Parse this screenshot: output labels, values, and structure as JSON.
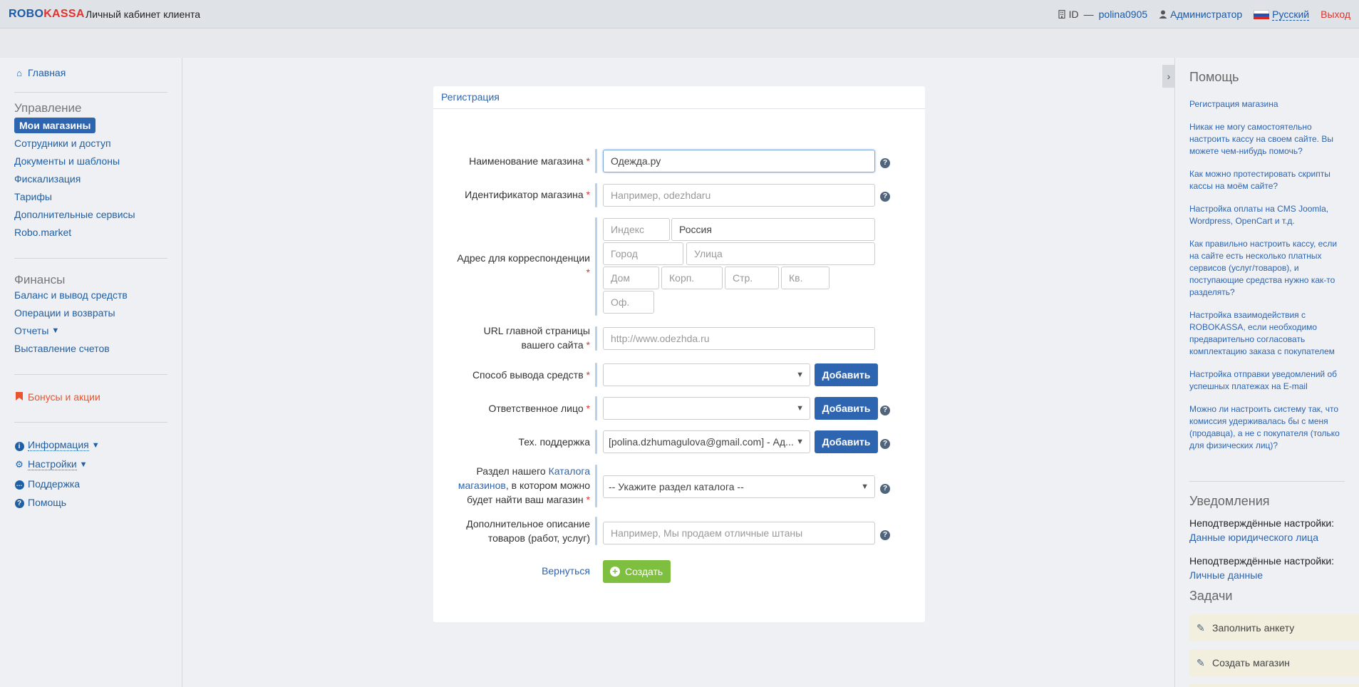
{
  "header": {
    "logo_robo": "ROBO",
    "logo_kassa": "KASSA",
    "cabinet_title": "Личный кабинет клиента",
    "id_label": "ID",
    "id_dash": "—",
    "user_login": "polina0905",
    "role": "Администратор",
    "language": "Русский",
    "logout": "Выход"
  },
  "sidebar": {
    "home": "Главная",
    "management_heading": "Управление",
    "active_item": "Мои магазины",
    "management_items": [
      "Сотрудники и доступ",
      "Документы и шаблоны",
      "Фискализация",
      "Тарифы",
      "Дополнительные сервисы",
      "Robo.market"
    ],
    "finance_heading": "Финансы",
    "finance_items": [
      "Баланс и вывод средств",
      "Операции и возвраты",
      "Отчеты",
      "Выставление счетов"
    ],
    "bonus": "Бонусы и акции",
    "info": "Информация",
    "settings": "Настройки",
    "support": "Поддержка",
    "help": "Помощь"
  },
  "form": {
    "title": "Регистрация",
    "shop_name_label": "Наименование магазина",
    "shop_name_value": "Одежда.ру",
    "shop_id_label": "Идентификатор магазина",
    "shop_id_placeholder": "Например, odezhdaru",
    "address_label": "Адрес для корреспонденции",
    "address_index": "Индекс",
    "address_country": "Россия",
    "address_city": "Город",
    "address_street": "Улица",
    "address_house": "Дом",
    "address_building": "Корп.",
    "address_structure": "Стр.",
    "address_flat": "Кв.",
    "address_office": "Оф.",
    "url_label_1": "URL главной страницы",
    "url_label_2": "вашего сайта",
    "url_placeholder": "http://www.odezhda.ru",
    "payout_label": "Способ вывода средств",
    "responsible_label": "Ответственное лицо",
    "support_label": "Тех. поддержка",
    "support_value": "[polina.dzhumagulova@gmail.com] - Ад...",
    "catalog_label_1": "Раздел нашего",
    "catalog_link_1": "Каталога",
    "catalog_link_2": "магазинов",
    "catalog_label_2": ", в котором можно",
    "catalog_label_3": "будет найти ваш магазин",
    "catalog_value": "-- Укажите раздел каталога --",
    "desc_label_1": "Дополнительное описание",
    "desc_label_2": "товаров (работ, услуг)",
    "desc_placeholder": "Например, Мы продаем отличные штаны",
    "add_button": "Добавить",
    "back": "Вернуться",
    "create": "Создать",
    "required_mark": "*"
  },
  "help_panel": {
    "title": "Помощь",
    "links": [
      "Регистрация магазина",
      "Никак не могу самостоятельно настроить кассу на своем сайте. Вы можете чем-нибудь помочь?",
      "Как можно протестировать скрипты кассы на моём сайте?",
      "Настройка оплаты на CMS Joomla, Wordpress, OpenCart и т.д.",
      "Как правильно настроить кассу, если на сайте есть несколько платных сервисов (услуг/товаров), и поступающие средства нужно как-то разделять?",
      "Настройка взаимодействия с ROBOKASSA, если необходимо предварительно согласовать комплектацию заказа с покупателем",
      "Настройка отправки уведомлений об успешных платежах на E-mail",
      "Можно ли настроить систему так, что комиссия удерживалась бы с меня (продавца), а не с покупателя (только для физических лиц)?"
    ],
    "notifications_title": "Уведомления",
    "unconfirmed_label": "Неподтверждённые настройки:",
    "unconfirmed_1": "Данные юридического лица",
    "unconfirmed_2": "Личные данные",
    "tasks_title": "Задачи",
    "tasks": [
      "Заполнить анкету",
      "Создать магазин"
    ]
  },
  "colors": {
    "brand_blue": "#1a5aa8",
    "brand_red": "#e0332b",
    "button_blue": "#2e65b0",
    "create_green": "#7fbf3f",
    "bonus_orange": "#e8542e"
  },
  "icons": [
    "building-icon",
    "user-icon",
    "flag-ru-icon",
    "home-icon",
    "bookmark-icon",
    "info-icon",
    "gear-icon",
    "chat-icon",
    "question-icon",
    "plus-circle-icon",
    "pin-icon",
    "chevron-right-icon",
    "caret-down-icon"
  ]
}
